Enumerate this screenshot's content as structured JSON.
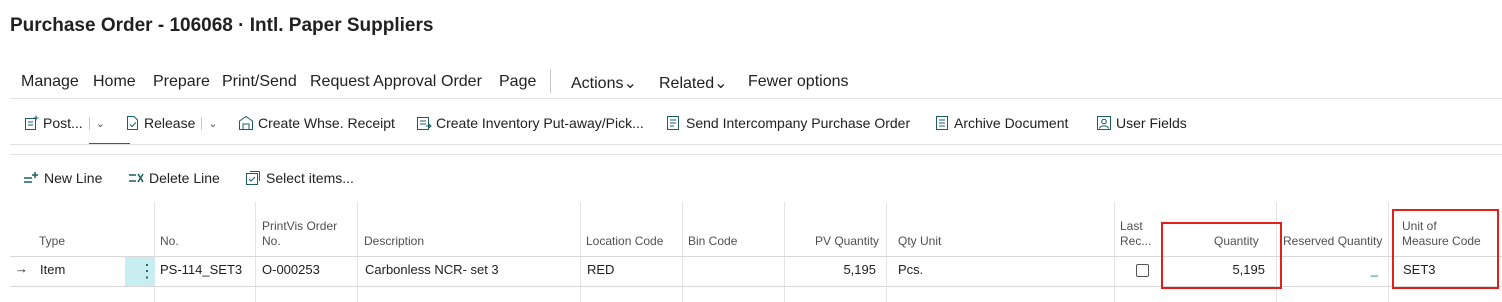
{
  "page": {
    "title": "Purchase Order - 106068 · Intl. Paper Suppliers"
  },
  "menu": {
    "items": [
      {
        "label": "Manage"
      },
      {
        "label": "Home"
      },
      {
        "label": "Prepare"
      },
      {
        "label": "Print/Send"
      },
      {
        "label": "Request Approval"
      },
      {
        "label": "Order"
      },
      {
        "label": "Page"
      },
      {
        "label": "Actions"
      },
      {
        "label": "Related"
      },
      {
        "label": "Fewer options"
      }
    ],
    "active": "Home"
  },
  "actions": {
    "post": "Post...",
    "release": "Release",
    "create_whse_receipt": "Create Whse. Receipt",
    "create_inventory": "Create Inventory Put-away/Pick...",
    "send_ic": "Send Intercompany Purchase Order",
    "archive": "Archive Document",
    "user_fields": "User Fields"
  },
  "lines_toolbar": {
    "new_line": "New Line",
    "delete_line": "Delete Line",
    "select_items": "Select items..."
  },
  "grid": {
    "headers": {
      "type": "Type",
      "no": "No.",
      "printvis_1": "PrintVis Order",
      "printvis_2": "No.",
      "description": "Description",
      "location": "Location Code",
      "bin": "Bin Code",
      "pv_qty": "PV Quantity",
      "qty_unit": "Qty Unit",
      "last_rec_1": "Last",
      "last_rec_2": "Rec...",
      "quantity": "Quantity",
      "reserved": "Reserved Quantity",
      "uom_1": "Unit of",
      "uom_2": "Measure Code"
    },
    "row": {
      "arrow": "→",
      "type": "Item",
      "no": "PS-114_SET3",
      "printvis": "O-000253",
      "description": "Carbonless NCR- set 3",
      "location": "RED",
      "bin": "",
      "pv_qty": "5,195",
      "qty_unit": "Pcs.",
      "last_rec_checked": false,
      "quantity": "5,195",
      "reserved": "_",
      "uom": "SET3"
    }
  },
  "colors": {
    "accent": "#00777c",
    "highlight_box": "#e0201b",
    "selected_cell": "#c8eef1"
  }
}
